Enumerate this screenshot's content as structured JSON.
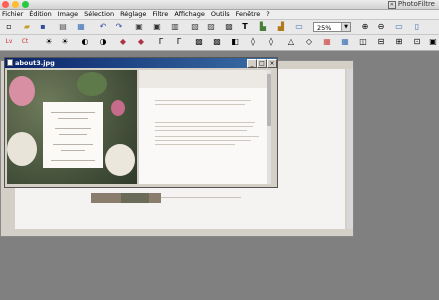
{
  "app": {
    "title": "PhotoFiltre"
  },
  "menu": [
    "Fichier",
    "Édition",
    "Image",
    "Sélection",
    "Réglage",
    "Filtre",
    "Affichage",
    "Outils",
    "Fenêtre",
    "?"
  ],
  "toolbar": {
    "zoom_value": "25%"
  },
  "document_window": {
    "title": "about3.jpg"
  },
  "colors": {
    "titlebar_active": "#0a246a",
    "workspace": "#808080"
  }
}
